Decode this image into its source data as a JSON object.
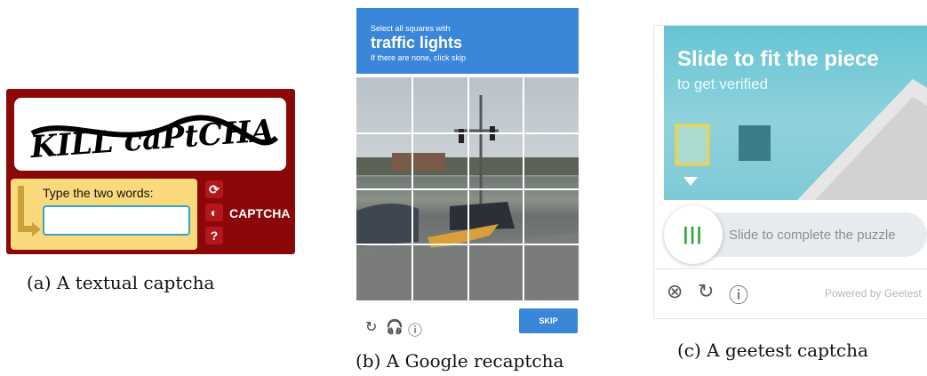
{
  "panel_a": {
    "distorted_text": "KILL caPtCHA",
    "prompt": "Type the two words:",
    "answer_value": "",
    "buttons": [
      "refresh-icon",
      "audio-icon",
      "help-icon"
    ],
    "brand": "CAPTCHA",
    "caption": "(a) A textual captcha"
  },
  "panel_b": {
    "header_line1": "Select all squares with",
    "header_line2": "traffic lights",
    "header_line3": "If there are none, click skip",
    "footer_icons": [
      "reload-icon",
      "headphones-icon",
      "info-icon"
    ],
    "skip_label": "SKIP",
    "caption": "(b) A Google recaptcha"
  },
  "panel_c": {
    "title": "Slide to fit the piece",
    "subtitle": "to get verified",
    "handle_label": "|||",
    "slide_text": "Slide to complete the puzzle",
    "footer_icons": [
      "close-icon",
      "refresh-icon",
      "info-icon"
    ],
    "powered": "Powered by Geetest",
    "caption": "(c) A geetest captcha"
  },
  "colors": {
    "captcha_red": "#8b0808",
    "captcha_yellow": "#f9d97b",
    "recaptcha_blue": "#3a86d8",
    "geetest_green": "#2ea33a"
  },
  "glyphs": {
    "refresh": "⟳",
    "audio": "◐",
    "help": "?",
    "reload": "↻",
    "headphones": "🎧",
    "info": "ⓘ",
    "close": "⊗"
  }
}
